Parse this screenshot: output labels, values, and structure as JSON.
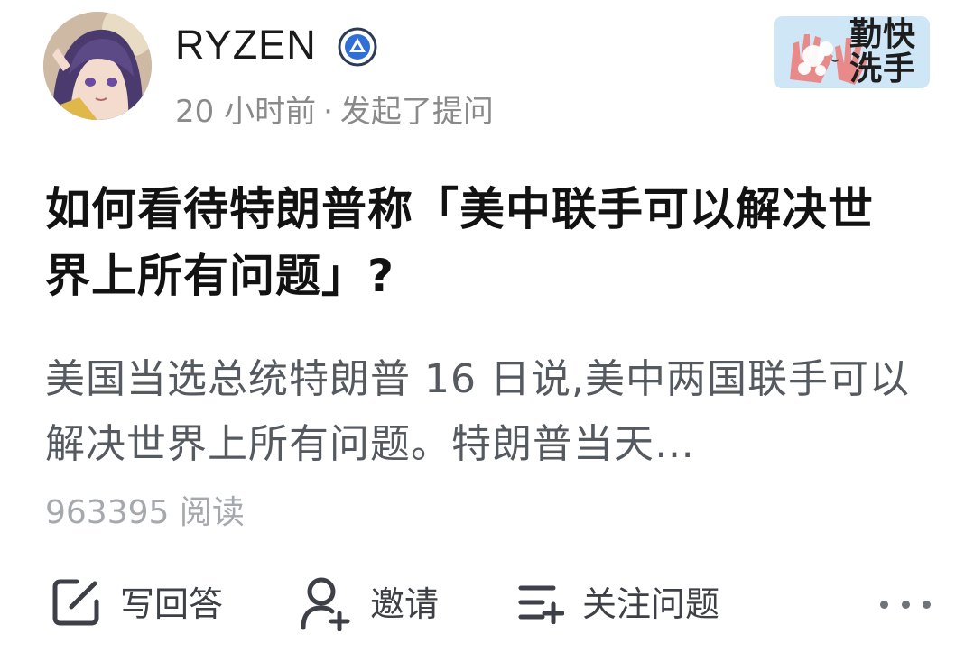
{
  "author": {
    "name": "RYZEN",
    "avatar_icon": "avatar-anime-girl",
    "verified_icon": "verified-badge-icon"
  },
  "meta": {
    "time": "20 小时前",
    "separator": "·",
    "action": "发起了提问"
  },
  "badge": {
    "text": "勤快洗手",
    "icon": "hand-washing-sticker"
  },
  "question": {
    "title": "如何看待特朗普称「美中联手可以解决世界上所有问题」?",
    "excerpt": "美国当选总统特朗普 16 日说,美中两国联手可以解决世界上所有问题。特朗普当天…",
    "reads": "963395 阅读"
  },
  "actions": {
    "write_answer": "写回答",
    "invite": "邀请",
    "follow": "关注问题"
  },
  "colors": {
    "title": "#121212",
    "excerpt": "#555a61",
    "muted": "#8a8a8a",
    "badge_bg": "#cfe6f7",
    "verified_blue": "#2f6fd6"
  }
}
